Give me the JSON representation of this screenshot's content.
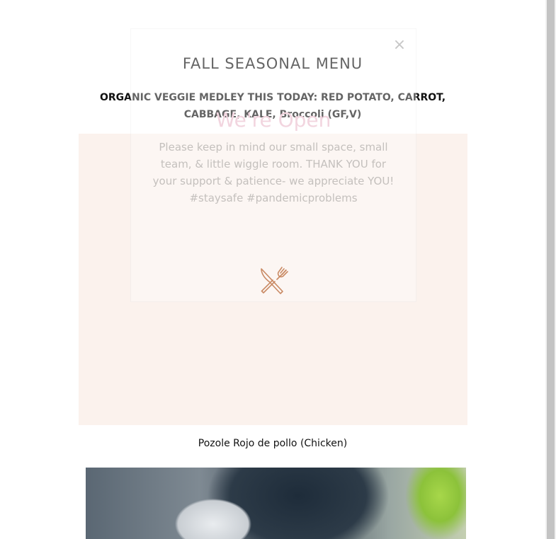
{
  "page": {
    "title": "FALL SEASONAL MENU",
    "subtitle": "ORGANIC VEGGIE MEDLEY THIS TODAY: RED POTATO, CARROT, CABBAGE, KALE, Broccoli (GF,V)"
  },
  "dish": {
    "caption": "Pozole Rojo de pollo (Chicken)"
  },
  "modal": {
    "close_label": "×",
    "heading": "We're Open",
    "body": "Please keep in mind our small space, small team, & little wiggle room.  THANK YOU for your support & patience- we appreciate YOU! #staysafe #pandemicproblems",
    "icon": "utensils-icon"
  },
  "colors": {
    "panel_bg": "#fbf2ed",
    "heading_pink": "#f2d5df",
    "icon_copper": "#c98a64"
  }
}
